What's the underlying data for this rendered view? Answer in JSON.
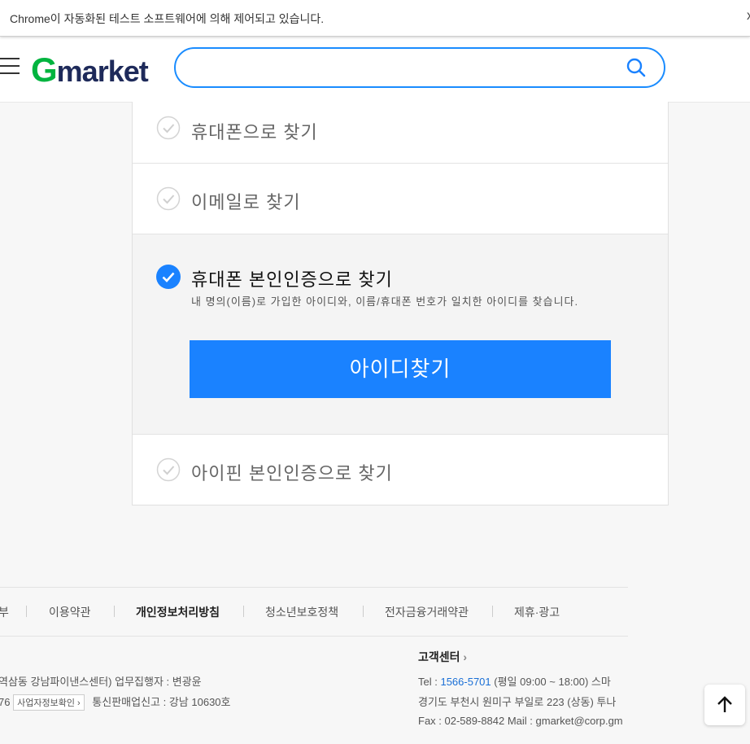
{
  "infobar": {
    "text": "Chrome이 자동화된 테스트 소프트웨어에 의해 제어되고 있습니다.",
    "close": "x"
  },
  "header": {
    "logo_g": "G",
    "logo_rest": "market",
    "search_value": ""
  },
  "options": [
    {
      "label": "휴대폰으로 찾기",
      "checked": false
    },
    {
      "label": "이메일로 찾기",
      "checked": false
    },
    {
      "label": "휴대폰 본인인증으로 찾기",
      "checked": true,
      "description": "내 명의(이름)로 가입한 아이디와, 이름/휴대폰 번호가 일치한 아이디를 찾습니다.",
      "button": "아이디찾기"
    },
    {
      "label": "아이핀 본인인증으로 찾기",
      "checked": false
    }
  ],
  "footer": {
    "links": [
      "부",
      "이용약관",
      "개인정보처리방침",
      "청소년보호정책",
      "전자금융거래약관",
      "제휴·광고"
    ],
    "address_line": "역삼동 강남파이낸스센터)  업무집행자 : 변광윤",
    "reg_prefix": "76",
    "biz_button": "사업자정보확인",
    "mail_order": "통신판매업신고 : 강남 10630호",
    "cs_title": "고객센터",
    "tel_label": "Tel : ",
    "tel_number": "1566-5701",
    "tel_hours": " (평일 09:00 ~ 18:00)  스마",
    "cs_address": "경기도 부천시 원미구 부일로 223 (상동) 투나",
    "fax_mail": "Fax : 02-589-8842   Mail : gmarket@corp.gm"
  },
  "colors": {
    "accent": "#1a82ff",
    "logo_green": "#00b43f"
  }
}
